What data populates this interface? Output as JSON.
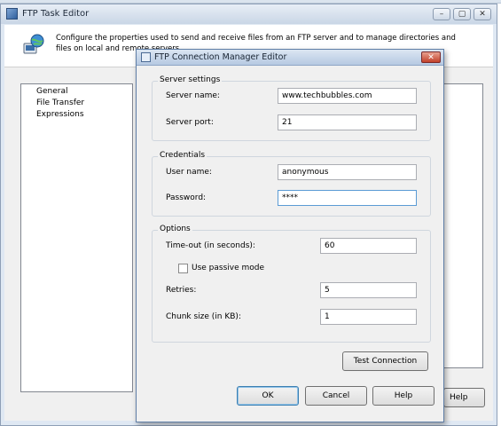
{
  "outer": {
    "title": "FTP Task Editor",
    "description": "Configure the properties used to send and receive files from an FTP server and to manage directories and files on local and remote servers.",
    "nav_items": [
      "General",
      "File Transfer",
      "Expressions"
    ],
    "help_label": "Help",
    "window_buttons": {
      "minimize": "–",
      "maximize": "▢",
      "close": "✕"
    }
  },
  "dialog": {
    "title": "FTP Connection Manager Editor",
    "close_glyph": "✕",
    "server_settings": {
      "title": "Server settings",
      "server_name_label": "Server name:",
      "server_name_value": "www.techbubbles.com",
      "server_port_label": "Server port:",
      "server_port_value": "21"
    },
    "credentials": {
      "title": "Credentials",
      "user_name_label": "User name:",
      "user_name_value": "anonymous",
      "password_label": "Password:",
      "password_value": "****"
    },
    "options": {
      "title": "Options",
      "timeout_label": "Time-out (in seconds):",
      "timeout_value": "60",
      "passive_label": "Use passive mode",
      "passive_checked": false,
      "retries_label": "Retries:",
      "retries_value": "5",
      "chunk_label": "Chunk size (in KB):",
      "chunk_value": "1"
    },
    "buttons": {
      "test_connection": "Test Connection",
      "ok": "OK",
      "cancel": "Cancel",
      "help": "Help"
    }
  }
}
